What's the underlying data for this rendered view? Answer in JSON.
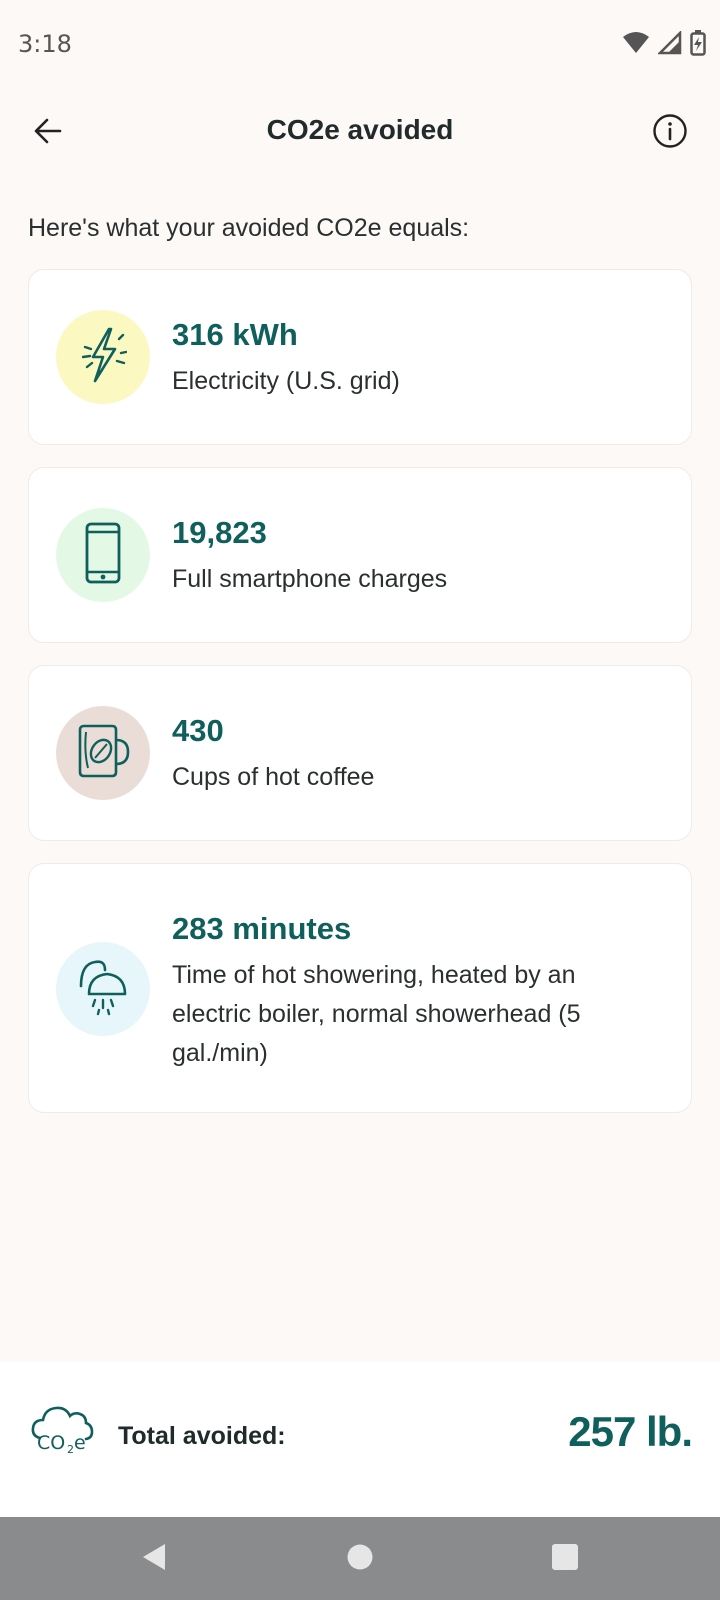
{
  "status_bar": {
    "time": "3:18",
    "icons": [
      "wifi-icon",
      "signal-icon",
      "battery-charging-icon"
    ]
  },
  "header": {
    "title": "CO2e avoided",
    "back_icon": "arrow-left-icon",
    "info_icon": "info-icon"
  },
  "intro": "Here's what your avoided CO2e equals:",
  "equivalents": [
    {
      "value": "316 kWh",
      "description": "Electricity (U.S. grid)",
      "icon": "lightning-bolt-icon",
      "icon_bg": "#fbf8c2"
    },
    {
      "value": "19,823",
      "description": "Full smartphone charges",
      "icon": "smartphone-icon",
      "icon_bg": "#e4f8e6"
    },
    {
      "value": "430",
      "description": "Cups of hot coffee",
      "icon": "coffee-mug-icon",
      "icon_bg": "#eaddd7"
    },
    {
      "value": "283 minutes",
      "description": "Time of hot showering, heated by an electric boiler, normal showerhead (5 gal./min)",
      "icon": "showerhead-icon",
      "icon_bg": "#e7f6fa"
    }
  ],
  "total": {
    "label": "Total avoided:",
    "value": "257 lb.",
    "icon": "co2e-cloud-icon"
  },
  "nav_bar": {
    "icons": [
      "nav-back-icon",
      "nav-home-icon",
      "nav-recents-icon"
    ]
  },
  "colors": {
    "accent": "#0f5f5c",
    "background": "#fcf9f7",
    "card": "#ffffff",
    "nav_bar": "#8a8b8c"
  }
}
